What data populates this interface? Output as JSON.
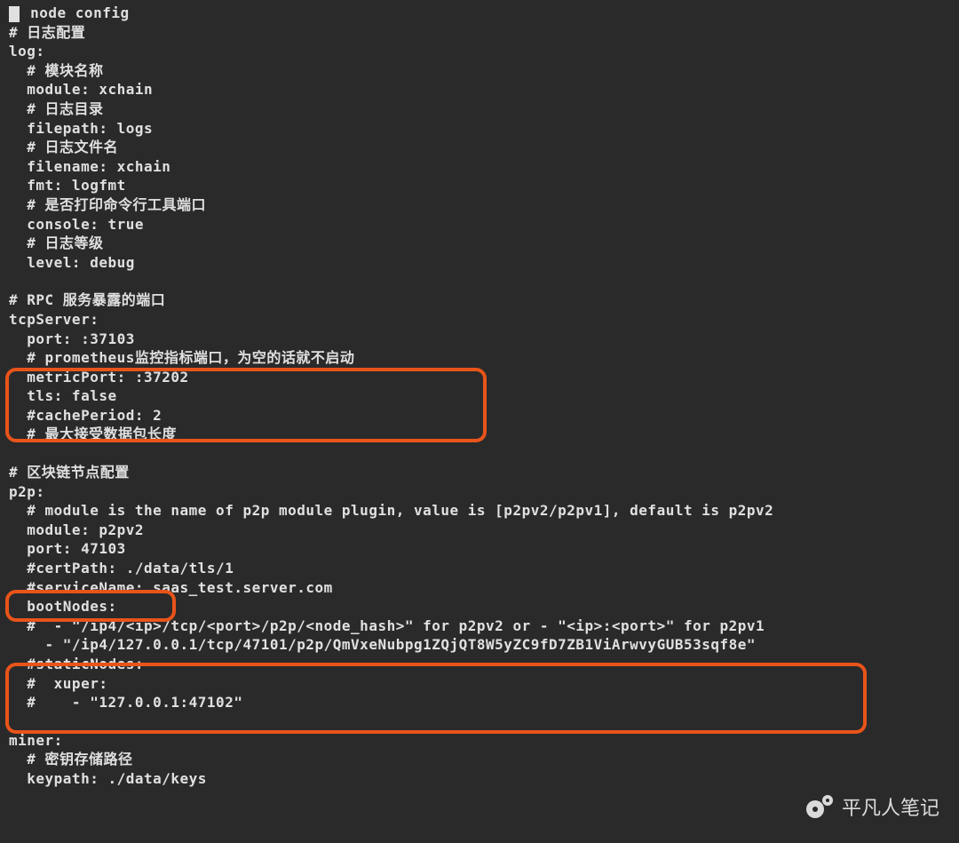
{
  "lines": [
    {
      "prefix_cursor": true,
      "text": " node config"
    },
    {
      "text": "# 日志配置"
    },
    {
      "text": "log:"
    },
    {
      "text": "  # 模块名称"
    },
    {
      "text": "  module: xchain"
    },
    {
      "text": "  # 日志目录"
    },
    {
      "text": "  filepath: logs"
    },
    {
      "text": "  # 日志文件名"
    },
    {
      "text": "  filename: xchain"
    },
    {
      "text": "  fmt: logfmt"
    },
    {
      "text": "  # 是否打印命令行工具端口"
    },
    {
      "text": "  console: true"
    },
    {
      "text": "  # 日志等级"
    },
    {
      "text": "  level: debug"
    },
    {
      "text": ""
    },
    {
      "text": "# RPC 服务暴露的端口"
    },
    {
      "text": "tcpServer:"
    },
    {
      "text": "  port: :37103"
    },
    {
      "text": "  # prometheus监控指标端口，为空的话就不启动"
    },
    {
      "text": "  metricPort: :37202"
    },
    {
      "text": "  tls: false"
    },
    {
      "text": "  #cachePeriod: 2"
    },
    {
      "text": "  # 最大接受数据包长度"
    },
    {
      "text": ""
    },
    {
      "text": "# 区块链节点配置"
    },
    {
      "text": "p2p:"
    },
    {
      "text": "  # module is the name of p2p module plugin, value is [p2pv2/p2pv1], default is p2pv2"
    },
    {
      "text": "  module: p2pv2"
    },
    {
      "text": "  port: 47103"
    },
    {
      "text": "  #certPath: ./data/tls/1"
    },
    {
      "text": "  #serviceName: saas_test.server.com"
    },
    {
      "text": "  bootNodes:"
    },
    {
      "text": "  #  - \"/ip4/<ip>/tcp/<port>/p2p/<node_hash>\" for p2pv2 or - \"<ip>:<port>\" for p2pv1"
    },
    {
      "text": "    - \"/ip4/127.0.0.1/tcp/47101/p2p/QmVxeNubpg1ZQjQT8W5yZC9fD7ZB1ViArwvyGUB53sqf8e\""
    },
    {
      "text": "  #staticNodes:"
    },
    {
      "text": "  #  xuper:"
    },
    {
      "text": "  #    - \"127.0.0.1:47102\""
    },
    {
      "text": ""
    },
    {
      "text": "miner:"
    },
    {
      "text": "  # 密钥存储路径"
    },
    {
      "text": "  keypath: ./data/keys"
    }
  ],
  "watermark_text": "平凡人笔记"
}
